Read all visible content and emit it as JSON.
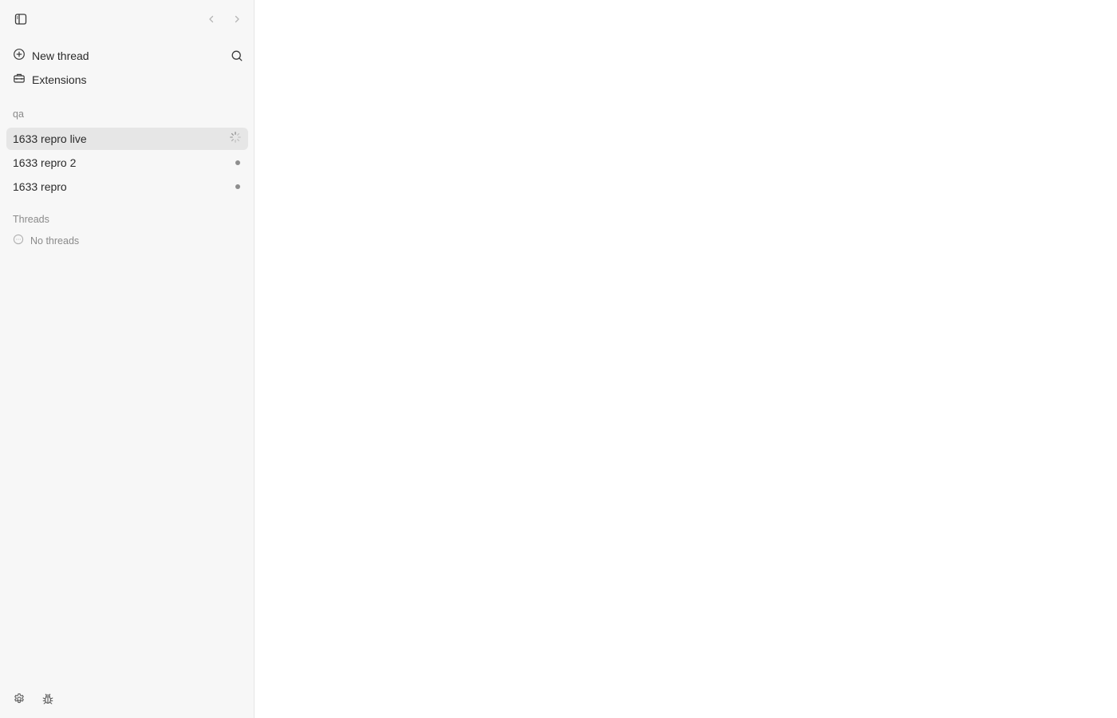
{
  "sidebar": {
    "new_thread_label": "New thread",
    "extensions_label": "Extensions",
    "project": {
      "name": "qa",
      "threads": [
        {
          "label": "1633 repro live",
          "status": "running"
        },
        {
          "label": "1633 repro 2",
          "status": "idle"
        },
        {
          "label": "1633 repro",
          "status": "idle"
        }
      ]
    },
    "threads_section": {
      "title": "Threads",
      "empty_label": "No threads"
    }
  },
  "icons": {
    "toggle_sidebar": "sidebar-toggle-icon",
    "back": "chevron-left-icon",
    "forward": "chevron-right-icon",
    "new_thread": "plus-circle-icon",
    "search": "search-icon",
    "extensions": "toolbox-icon",
    "running": "spinner-icon",
    "empty": "chat-bubble-icon",
    "settings": "gear-icon",
    "debug": "bug-icon"
  },
  "colors": {
    "sidebar_bg": "#f7f7f7",
    "active_row_bg": "#e6e6e6",
    "muted_text": "#8a8a8a",
    "main_bg": "#ffffff"
  }
}
